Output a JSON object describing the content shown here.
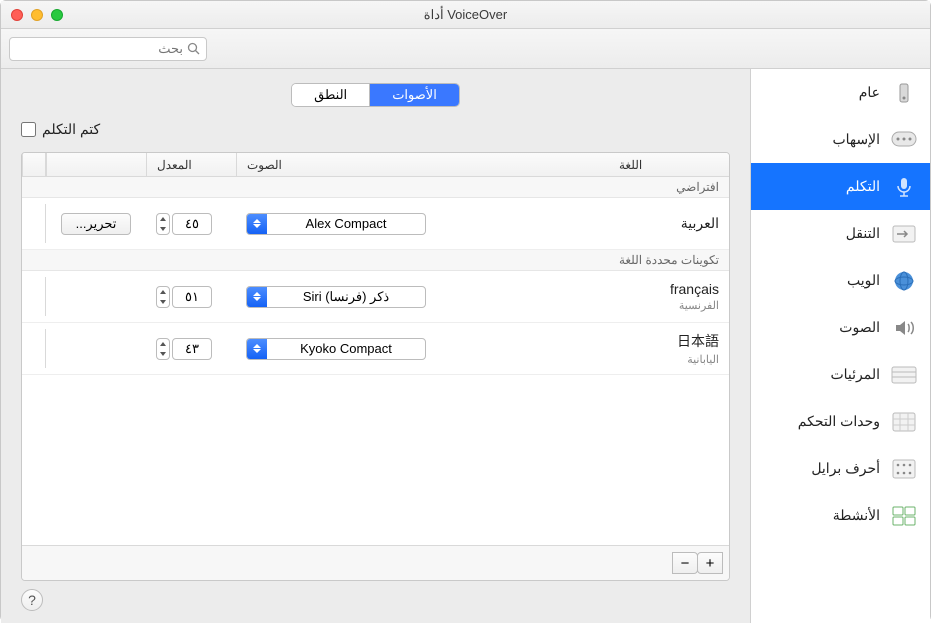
{
  "window": {
    "title": "أداة VoiceOver"
  },
  "search": {
    "placeholder": "بحث"
  },
  "sidebar": {
    "items": [
      {
        "label": "عام",
        "icon": "general"
      },
      {
        "label": "الإسهاب",
        "icon": "verbosity"
      },
      {
        "label": "التكلم",
        "icon": "speech",
        "selected": true
      },
      {
        "label": "التنقل",
        "icon": "navigation"
      },
      {
        "label": "الويب",
        "icon": "web"
      },
      {
        "label": "الصوت",
        "icon": "sound"
      },
      {
        "label": "المرئيات",
        "icon": "visuals"
      },
      {
        "label": "وحدات التحكم",
        "icon": "commanders"
      },
      {
        "label": "أحرف برايل",
        "icon": "braille"
      },
      {
        "label": "الأنشطة",
        "icon": "activities"
      }
    ]
  },
  "tabs": {
    "voices": "الأصوات",
    "pronunciation": "النطق"
  },
  "mute_label": "كتم التكلم",
  "columns": {
    "language": "اللغة",
    "voice": "الصوت",
    "rate": "المعدل"
  },
  "groups": {
    "default": "افتراضي",
    "language_specific": "تكوينات محددة اللغة"
  },
  "rows": {
    "default": {
      "lang_native": "العربية",
      "voice": "Alex Compact",
      "rate": "٤٥",
      "edit": "تحرير..."
    },
    "fr": {
      "lang_native": "français",
      "lang_ar": "الفرنسية",
      "voice": "Siri ذكر (فرنسا)",
      "rate": "٥١"
    },
    "ja": {
      "lang_native": "日本語",
      "lang_ar": "اليابانية",
      "voice": "Kyoko Compact",
      "rate": "٤٣"
    }
  },
  "footer": {
    "add": "+",
    "remove": "−"
  },
  "help": "?"
}
